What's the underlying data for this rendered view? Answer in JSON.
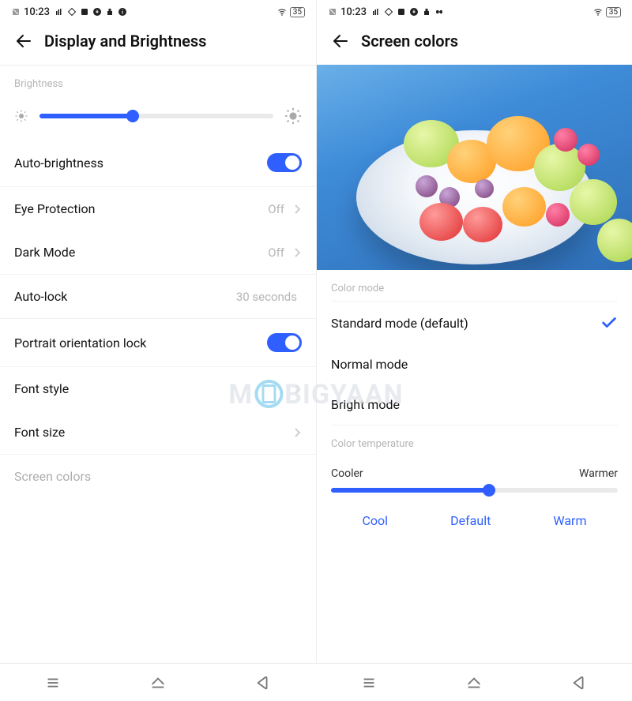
{
  "statusbar": {
    "time": "10:23",
    "battery": "35"
  },
  "left": {
    "title": "Display and Brightness",
    "section_brightness": "Brightness",
    "brightness_percent": 40,
    "rows": {
      "auto_brightness": "Auto-brightness",
      "eye_protection": {
        "label": "Eye Protection",
        "value": "Off"
      },
      "dark_mode": {
        "label": "Dark Mode",
        "value": "Off"
      },
      "auto_lock": {
        "label": "Auto-lock",
        "value": "30 seconds"
      },
      "portrait_lock": "Portrait orientation lock",
      "font_style": "Font style",
      "font_size": "Font size",
      "screen_colors": "Screen colors"
    }
  },
  "right": {
    "title": "Screen colors",
    "section_color_mode": "Color mode",
    "modes": {
      "standard": "Standard mode (default)",
      "normal": "Normal mode",
      "bright": "Bright mode"
    },
    "section_temp": "Color temperature",
    "temp_labels": {
      "cool": "Cooler",
      "warm": "Warmer"
    },
    "temp_percent": 55,
    "temp_buttons": {
      "cool": "Cool",
      "default": "Default",
      "warm": "Warm"
    }
  },
  "watermark": {
    "m": "M",
    "rest": "BIGYAAN"
  }
}
